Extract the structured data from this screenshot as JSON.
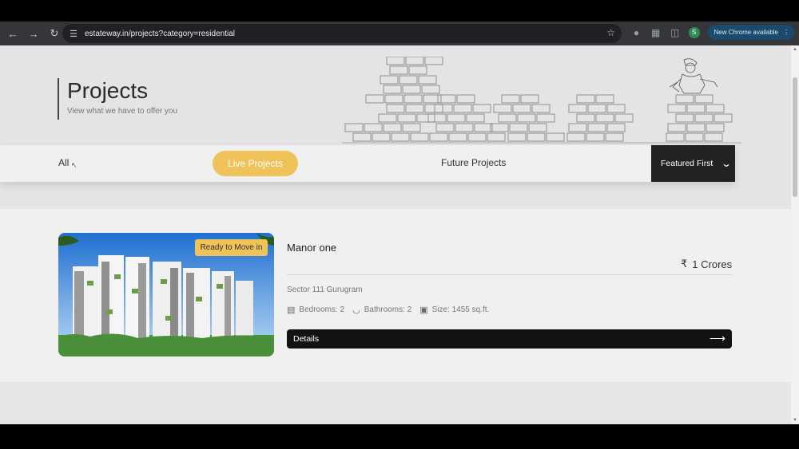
{
  "browser": {
    "url": "estateway.in/projects?category=residential",
    "update_label": "New Chrome available",
    "profile_initial": "S",
    "icons": [
      "back-icon",
      "forward-icon",
      "reload-icon",
      "tune-icon",
      "star-icon",
      "extension-icon",
      "puzzle-icon",
      "sidepanel-icon",
      "profile-icon",
      "more-icon"
    ]
  },
  "hero": {
    "title": "Projects",
    "subtitle": "View what we have to offer you"
  },
  "filters": {
    "all": "All",
    "live": "Live Projects",
    "future": "Future Projects",
    "sort": "Featured First",
    "active": "live",
    "accent_color": "#f0c25a"
  },
  "project": {
    "badge": "Ready to Move in",
    "name": "Manor one",
    "currency_symbol": "₹",
    "price": "1 Crores",
    "location": "Sector 111 Gurugram",
    "bedrooms": "Bedrooms: 2",
    "bathrooms": "Bathrooms: 2",
    "size": "Size: 1455 sq.ft.",
    "details_label": "Details"
  }
}
